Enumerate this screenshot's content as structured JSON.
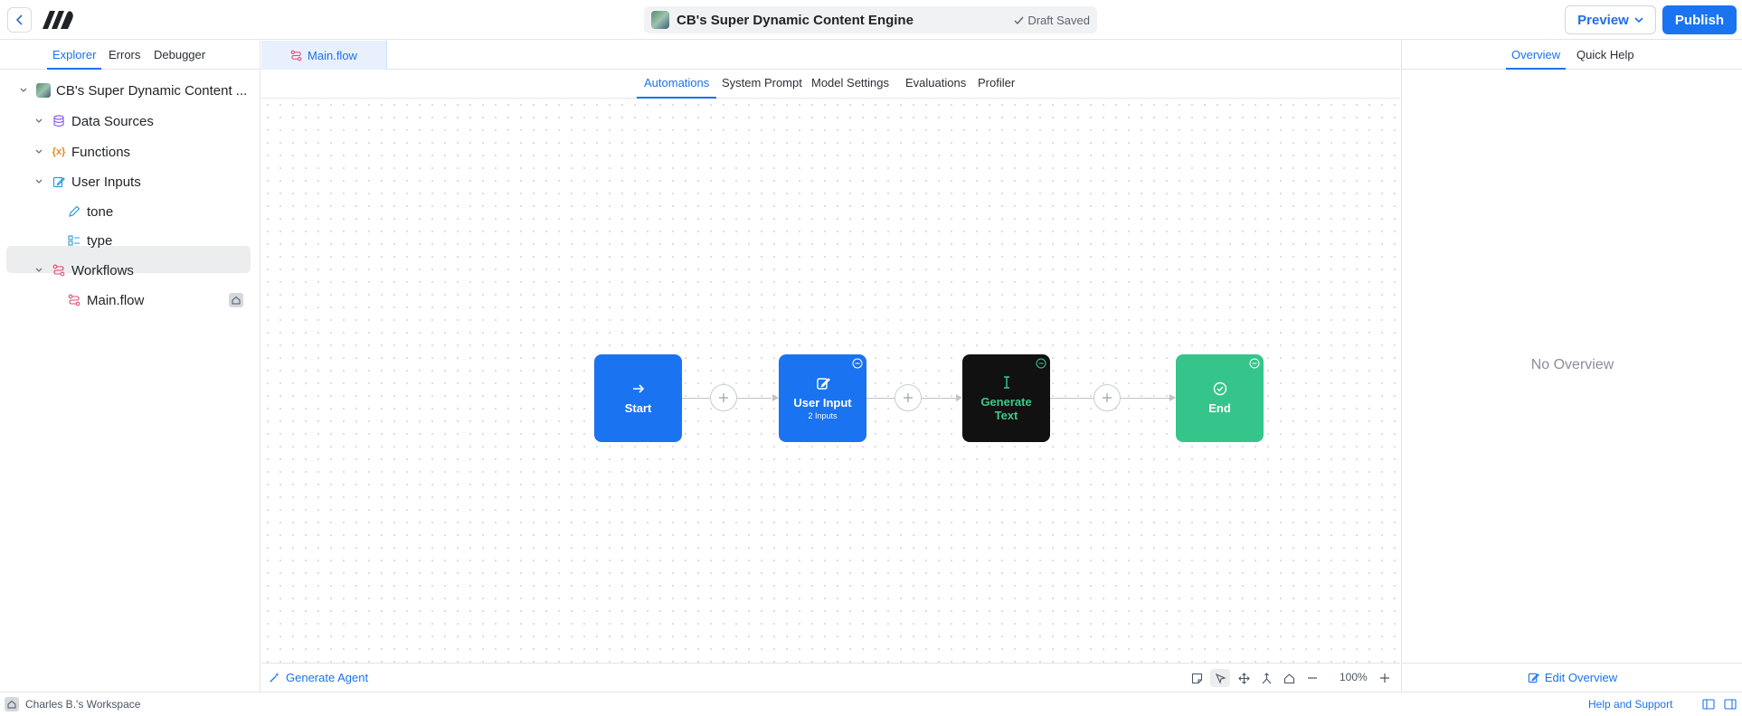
{
  "header": {
    "project_title": "CB's Super Dynamic Content Engine",
    "save_status": "Draft Saved",
    "preview_label": "Preview",
    "publish_label": "Publish"
  },
  "left_panel": {
    "tabs": [
      {
        "label": "Explorer",
        "active": true
      },
      {
        "label": "Errors",
        "active": false
      },
      {
        "label": "Debugger",
        "active": false
      }
    ],
    "tree": {
      "root": "CB's Super Dynamic Content ...",
      "data_sources": "Data Sources",
      "functions": "Functions",
      "user_inputs": "User Inputs",
      "input_tone": "tone",
      "input_type": "type",
      "workflows": "Workflows",
      "main_flow": "Main.flow"
    }
  },
  "editor": {
    "open_file": "Main.flow",
    "tabs": [
      {
        "label": "Automations",
        "active": true
      },
      {
        "label": "System Prompt",
        "active": false
      },
      {
        "label": "Model Settings",
        "active": false
      },
      {
        "label": "Evaluations",
        "active": false
      },
      {
        "label": "Profiler",
        "active": false
      }
    ],
    "nodes": {
      "start": "Start",
      "user_input": "User Input",
      "user_input_sub": "2 Inputs",
      "generate_text": "Generate Text",
      "end": "End"
    },
    "bottom": {
      "generate_agent": "Generate Agent",
      "zoom": "100%"
    }
  },
  "right_panel": {
    "tabs": [
      {
        "label": "Overview",
        "active": true
      },
      {
        "label": "Quick Help",
        "active": false
      }
    ],
    "empty_text": "No Overview",
    "edit_label": "Edit Overview"
  },
  "statusbar": {
    "workspace": "Charles B.'s Workspace",
    "help": "Help and Support"
  },
  "colors": {
    "accent": "#1a73f0",
    "start_node": "#1a73f0",
    "user_input_node": "#1a73f0",
    "generate_node": "#111111",
    "generate_text": "#3ec98a",
    "end_node": "#35c58a"
  }
}
